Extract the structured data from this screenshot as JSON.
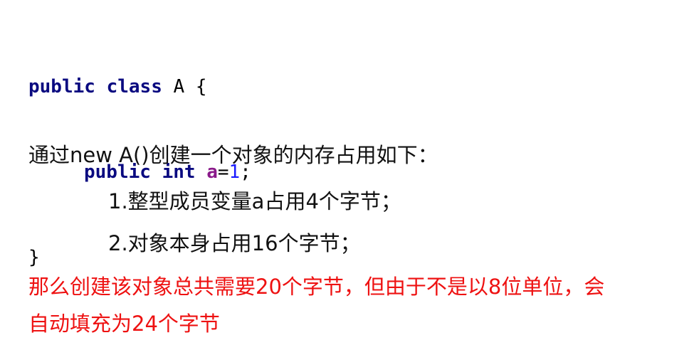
{
  "code": {
    "line1": {
      "kw1": "public",
      "kw2": "class",
      "name": "A",
      "brace": "{"
    },
    "line2": {
      "kw1": "public",
      "kw2": "int",
      "field": "a",
      "eq": "=",
      "value": "1",
      "semi": ";"
    },
    "line3": {
      "brace": "}"
    }
  },
  "text": {
    "intro": "通过new A()创建一个对象的内存占用如下：",
    "item1": "1.整型成员变量a占用4个字节；",
    "item2": "2.对象本身占用16个字节；",
    "conclusion_line1": "那么创建该对象总共需要20个字节，但由于不是以8位单位，会",
    "conclusion_line2": "自动填充为24个字节"
  },
  "colors": {
    "keyword": "#0a0a80",
    "field": "#8a1a8a",
    "number": "#1a1aff",
    "highlight_text": "#ee1111"
  }
}
